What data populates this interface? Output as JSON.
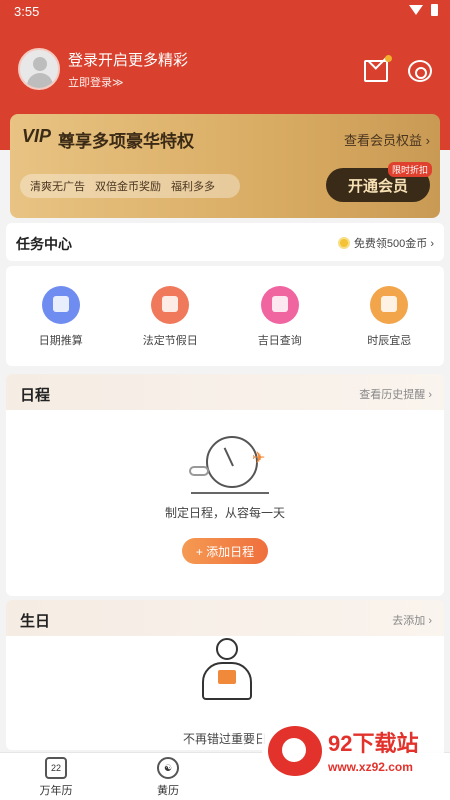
{
  "statusbar": {
    "time": "3:55"
  },
  "profile": {
    "title": "登录开启更多精彩",
    "link": "立即登录≫"
  },
  "header_icons": [
    "mail-icon",
    "gear-icon"
  ],
  "vip": {
    "logo": "VIP",
    "title": "尊享多项豪华特权",
    "link": "查看会员权益 ›",
    "perks": [
      "清爽无广告",
      "双倍金币奖励",
      "福利多多"
    ],
    "button": "开通会员",
    "tag": "限时折扣"
  },
  "task": {
    "title": "任务中心",
    "coin_text": "免费领500金币 ›"
  },
  "tools": [
    {
      "label": "日期推算",
      "color": "#6f8cf0"
    },
    {
      "label": "法定节假日",
      "color": "#f0795b"
    },
    {
      "label": "吉日查询",
      "color": "#f064a0"
    },
    {
      "label": "时辰宜忌",
      "color": "#f2a54a"
    }
  ],
  "schedule": {
    "title": "日程",
    "link": "查看历史提醒 ›",
    "empty_text": "制定日程，从容每一天",
    "add_button": "+ 添加日程"
  },
  "birthday": {
    "title": "生日",
    "link": "去添加 ›",
    "empty_text": "不再错过重要日"
  },
  "bottom_nav": [
    {
      "label": "万年历",
      "icon": "22"
    },
    {
      "label": "黄历",
      "icon": "☯"
    }
  ],
  "watermark": {
    "title": "92下载站",
    "url": "www.xz92.com"
  }
}
